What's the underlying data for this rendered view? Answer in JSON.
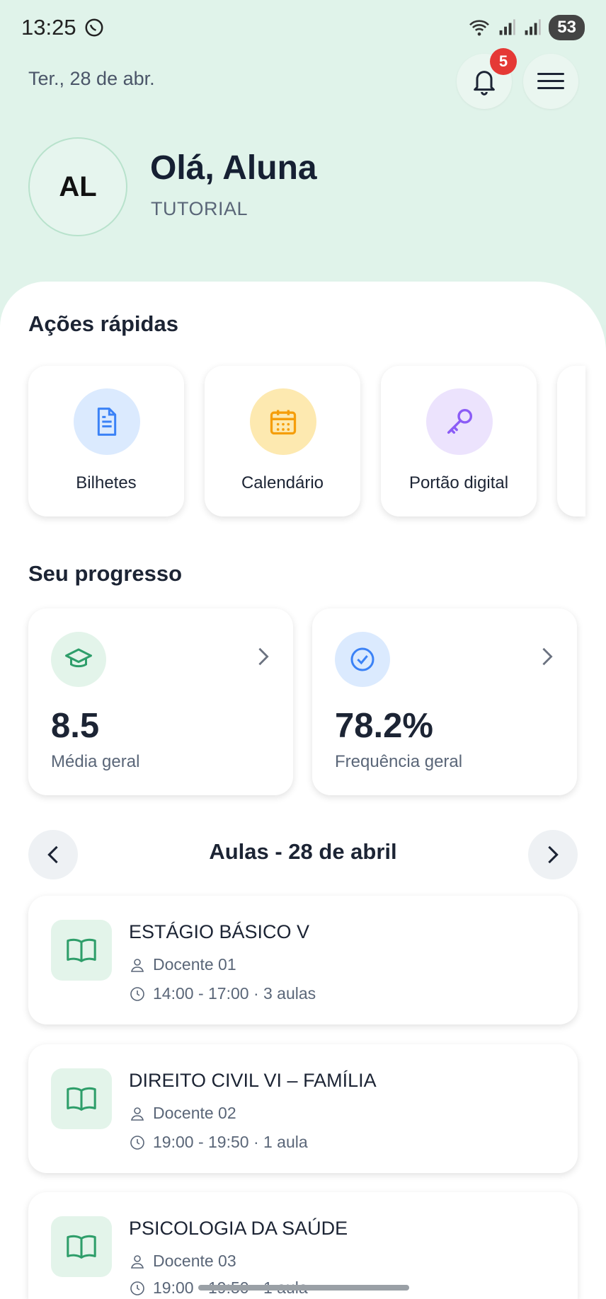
{
  "status_bar": {
    "time": "13:25",
    "battery": "53"
  },
  "header": {
    "date": "Ter., 28 de abr.",
    "notifications_count": "5"
  },
  "profile": {
    "initials": "AL",
    "greeting": "Olá, Aluna",
    "subtitle": "TUTORIAL"
  },
  "quick_actions": {
    "title": "Ações rápidas",
    "items": [
      {
        "label": "Bilhetes",
        "icon": "document-icon",
        "color": "#dbeafe"
      },
      {
        "label": "Calendário",
        "icon": "calendar-icon",
        "color": "#fde9b0"
      },
      {
        "label": "Portão digital",
        "icon": "key-icon",
        "color": "#ece3fd"
      }
    ]
  },
  "progress": {
    "title": "Seu progresso",
    "cards": [
      {
        "value": "8.5",
        "label": "Média geral",
        "icon": "graduation-cap-icon"
      },
      {
        "value": "78.2%",
        "label": "Frequência geral",
        "icon": "check-circle-icon"
      }
    ]
  },
  "classes": {
    "title": "Aulas - 28 de abril",
    "items": [
      {
        "title": "ESTÁGIO BÁSICO V",
        "teacher": "Docente 01",
        "time": "14:00 - 17:00 · 3 aulas"
      },
      {
        "title": "DIREITO CIVIL VI – FAMÍLIA",
        "teacher": "Docente 02",
        "time": "19:00 - 19:50 · 1 aula"
      },
      {
        "title": "PSICOLOGIA DA SAÚDE",
        "teacher": "Docente 03",
        "time": "19:00 - 19:50 · 1 aula"
      }
    ]
  },
  "colors": {
    "accent_green": "#2e9e6a",
    "badge_red": "#e53935"
  }
}
